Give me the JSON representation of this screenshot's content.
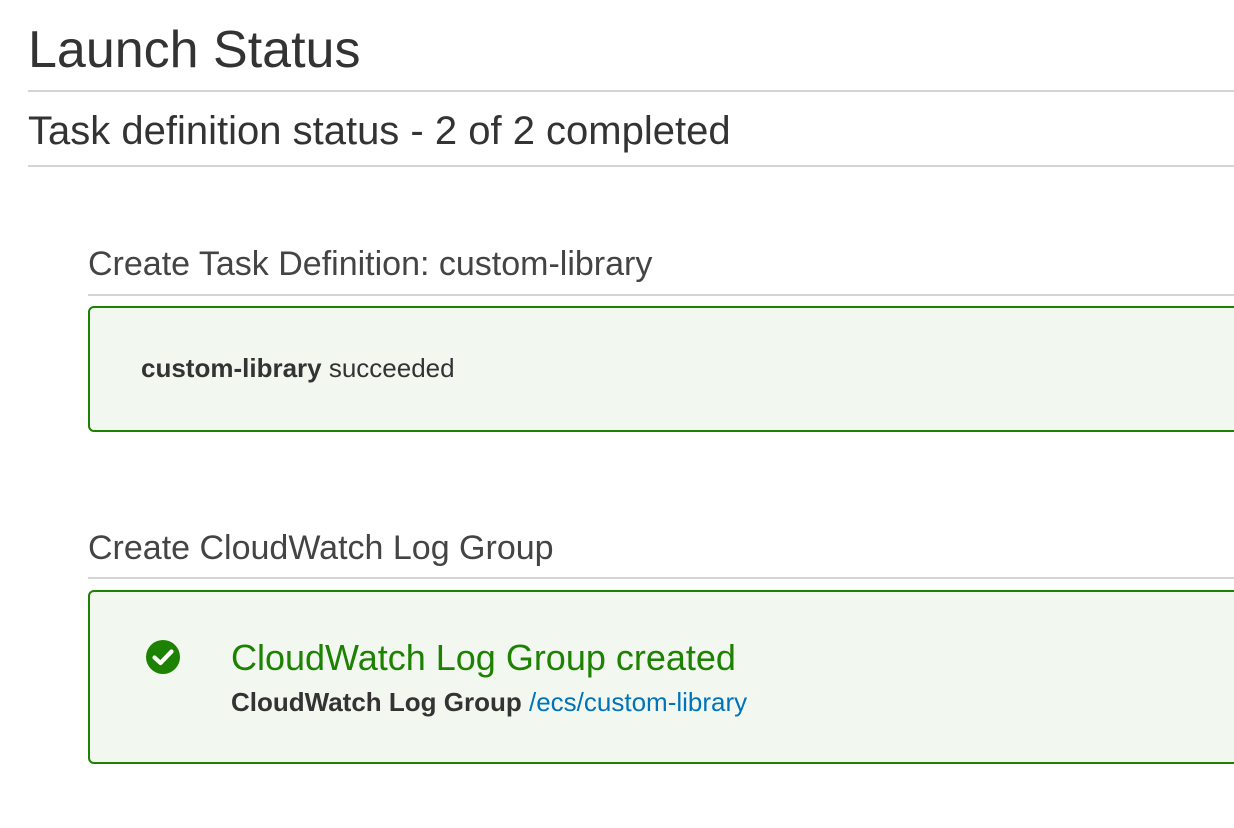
{
  "page": {
    "title": "Launch Status",
    "subtitle": "Task definition status - 2 of 2 completed"
  },
  "sections": [
    {
      "heading": "Create Task Definition: custom-library",
      "message_bold": "custom-library",
      "message_text": " succeeded"
    },
    {
      "heading": "Create CloudWatch Log Group",
      "status_title": "CloudWatch Log Group created",
      "detail_label": "CloudWatch Log Group",
      "detail_link": "/ecs/custom-library",
      "icon": "check-circle-icon"
    }
  ],
  "colors": {
    "success": "#1d8102",
    "success_bg": "#f2f8f0",
    "link": "#0073bb",
    "divider": "#d5d5d5"
  }
}
